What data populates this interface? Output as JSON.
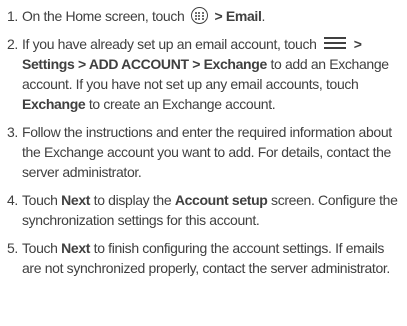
{
  "steps": [
    {
      "num": "1.",
      "t1": "On the Home screen, touch",
      "icon": "apps-icon",
      "b1": "> Email",
      "t2": "."
    },
    {
      "num": "2.",
      "t1": "If you have already set up an email account, touch",
      "icon": "menu-icon",
      "b1": "> Settings > ADD ACCOUNT > Exchange",
      "t2": "to add an Exchange account. If you have not set up any email accounts, touch",
      "b2": "Exchange",
      "t3": "to create an Exchange account."
    },
    {
      "num": "3.",
      "t1": "Follow the instructions and enter the required information about the Exchange account you want to add. For details, contact the server administrator."
    },
    {
      "num": "4.",
      "t1": "Touch",
      "b1": "Next",
      "t2": "to display the",
      "b2": "Account setup",
      "t3": "screen. Configure the synchronization settings for this account."
    },
    {
      "num": "5.",
      "t1": "Touch",
      "b1": "Next",
      "t2": "to finish configuring the account settings. If emails are not synchronized properly, contact the server administrator."
    }
  ]
}
